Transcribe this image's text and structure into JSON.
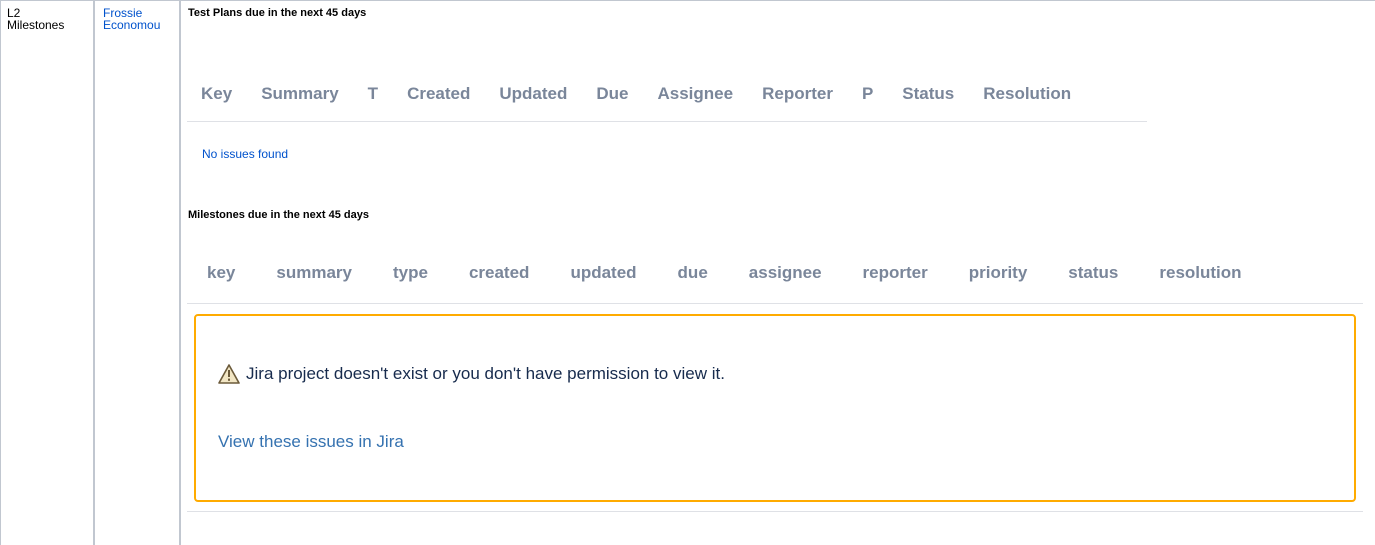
{
  "row": {
    "label_line1": "L2",
    "label_line2": "Milestones",
    "owner_line1": "Frossie",
    "owner_line2": "Economou"
  },
  "test_plans": {
    "title": "Test Plans due in the next 45 days",
    "columns": [
      "Key",
      "Summary",
      "T",
      "Created",
      "Updated",
      "Due",
      "Assignee",
      "Reporter",
      "P",
      "Status",
      "Resolution"
    ],
    "empty_message": "No issues found"
  },
  "milestones": {
    "title": "Milestones due in the next 45 days",
    "columns": [
      "key",
      "summary",
      "type",
      "created",
      "updated",
      "due",
      "assignee",
      "reporter",
      "priority",
      "status",
      "resolution"
    ],
    "warning": {
      "icon": "warning-triangle-icon",
      "message": "Jira project doesn't exist or you don't have permission to view it.",
      "link_text": "View these issues in Jira"
    }
  },
  "colors": {
    "link": "#0052cc",
    "header_text": "#7a869a",
    "warning_border": "#ffab00",
    "divider": "#c1c7d0"
  }
}
